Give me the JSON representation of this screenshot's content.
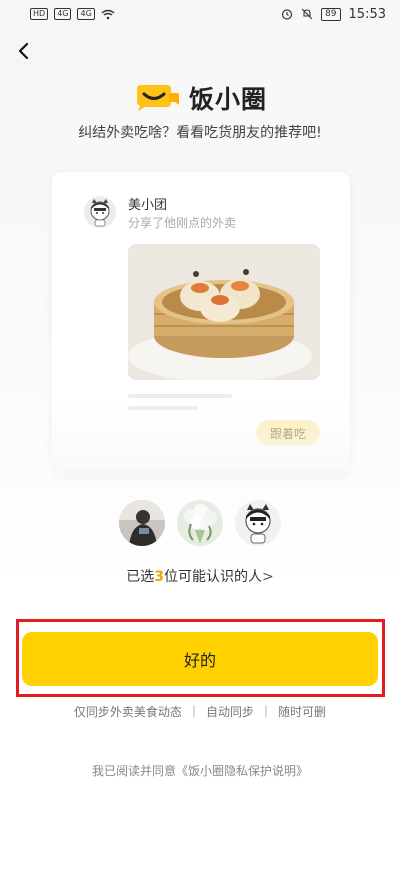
{
  "status_bar": {
    "left_badges": [
      "HD",
      "4G",
      "4G"
    ],
    "battery": "89",
    "time": "15:53"
  },
  "header": {
    "back_icon": "chevron-left-icon",
    "logo_icon": "chat-smile-icon",
    "title": "饭小圈",
    "subtitle": "纠结外卖吃啥？看看吃货朋友的推荐吧!"
  },
  "preview_card": {
    "user_name": "美小团",
    "description": "分享了他刚点的外卖",
    "photo": "steamed-shumai-in-bamboo-steamer",
    "follow_label": "跟着吃"
  },
  "friends": {
    "avatars": [
      "person-avatar",
      "flower-bouquet-avatar",
      "mascot-avatar"
    ],
    "selected_prefix": "已选",
    "selected_count": "3",
    "selected_suffix": "位可能认识的人",
    "arrow": ">"
  },
  "actions": {
    "ok_label": "好的",
    "sync_options": [
      "仅同步外卖美食动态",
      "自动同步",
      "随时可删"
    ],
    "separator": "|",
    "privacy_text": "我已阅读并同意《饭小圈隐私保护说明》"
  },
  "colors": {
    "accent": "#ffd100",
    "highlight": "#e21d1d",
    "count": "#f0a500"
  }
}
